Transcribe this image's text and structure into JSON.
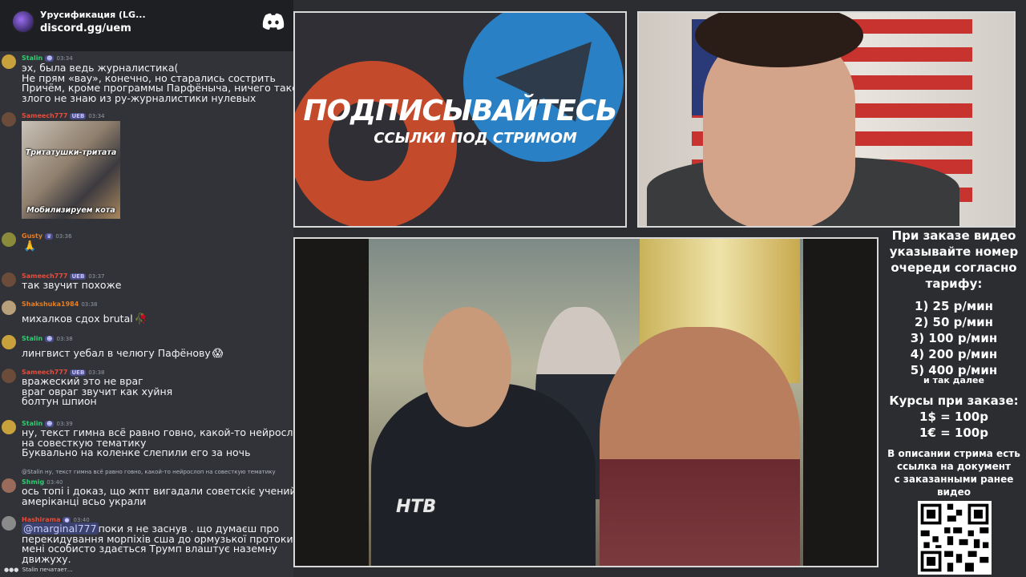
{
  "server": {
    "name": "Урусификация (LG...",
    "invite": "discord.gg/uem"
  },
  "messages": [
    {
      "user": "Stalin",
      "user_color": "#2ecc71",
      "time": "03:34",
      "lines": [
        "эх, была ведь журналистика(",
        "Не прям «вау», конечно, но старались сострить",
        "Причём, кроме программы Парфёныча, ничего такого",
        "злого не знаю из ру-журналистики нулевых"
      ]
    },
    {
      "user": "Sameech777",
      "user_color": "#e74c3c",
      "badge": "UEB",
      "time": "03:34",
      "image_captions": [
        "Тритатушки-тритата",
        "Мобилизируем кота"
      ]
    },
    {
      "user": "Gusty",
      "user_color": "#e67e22",
      "time": "03:36",
      "emoji": "🙏"
    },
    {
      "user": "Sameech777",
      "user_color": "#e74c3c",
      "badge": "UEB",
      "time": "03:37",
      "lines": [
        "так звучит похоже"
      ]
    },
    {
      "user": "Shakshuka1984",
      "user_color": "#e67e22",
      "time": "03:38",
      "lines": [
        "михалков сдох brutal"
      ],
      "emoji": "🥀"
    },
    {
      "user": "Stalin",
      "user_color": "#2ecc71",
      "time": "03:38",
      "lines": [
        "лингвист уебал в челюгу Пафёнову"
      ],
      "emoji": "😱"
    },
    {
      "user": "Sameech777",
      "user_color": "#e74c3c",
      "badge": "UEB",
      "time": "03:38",
      "lines": [
        "вражеский это не враг",
        "враг овраг звучит как хуйня",
        "болтун шпион"
      ]
    },
    {
      "user": "Stalin",
      "user_color": "#2ecc71",
      "time": "03:39",
      "lines": [
        "ну, текст гимна всё равно говно, какой-то нейрослоп",
        "на совесткую тематику",
        "Буквально на коленке слепили его за ночь"
      ]
    },
    {
      "user": "Shmig",
      "user_color": "#2ecc71",
      "time": "03:40",
      "reply": "@Stalin ну, текст гимна всё равно говно, какой-то нейрослоп на совесткую тематику",
      "lines": [
        "ось топі і доказ, що жпт вигадали советскіє учений, а",
        "амеріканці всьо украли"
      ]
    },
    {
      "user": "Hashirama",
      "user_color": "#e74c3c",
      "time": "03:40",
      "mention": "@marginal777",
      "lines": [
        "поки я не заснув . що думаєш про",
        "перекидування морпіхів сша до ормузької протоки .",
        "мені особисто здається Трумп влаштує наземну",
        "движуху."
      ]
    }
  ],
  "typing": "Stalin печатает...",
  "promo": {
    "title": "ПОДПИСЫВАЙТЕСЬ",
    "subtitle": "ССЫЛКИ ПОД СТРИМОМ"
  },
  "video": {
    "channel_logo": "НТВ"
  },
  "info": {
    "heading": [
      "При заказе видео",
      "указывайте номер",
      "очереди согласно",
      "тарифу:"
    ],
    "tariffs": [
      "1) 25 р/мин",
      "2) 50 р/мин",
      "3) 100 р/мин",
      "4) 200 р/мин",
      "5) 400 р/мин"
    ],
    "etc": "и так далее",
    "rates_title": "Курсы при заказе:",
    "rates": [
      "1$ = 100р",
      "1€ = 100р"
    ],
    "description": [
      "В описании стрима есть",
      "ссылка на документ",
      "с заказанными ранее",
      "видео"
    ]
  },
  "colors": {
    "discord_bg": "#313338",
    "discord_header": "#1e1f22",
    "panel_border": "#d8d8d8",
    "promo_red": "#c44a2c",
    "promo_blue": "#2a80c4"
  }
}
